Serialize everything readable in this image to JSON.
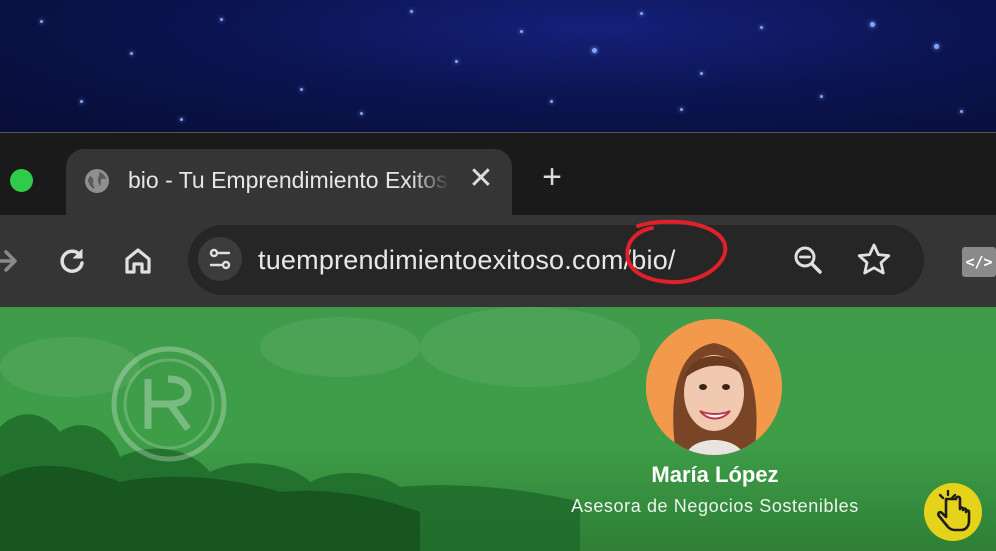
{
  "browser": {
    "tab": {
      "title": "bio - Tu Emprendimiento Exitoso",
      "close_symbol": "✕",
      "favicon": "globe-icon"
    },
    "new_tab_symbol": "+",
    "toolbar": {
      "back_icon": "arrow-right-icon",
      "reload_icon": "reload-icon",
      "home_icon": "home-icon",
      "site_info_icon": "tune-icon",
      "url": "tuemprendimientoexitoso.com/bio/",
      "zoom_icon": "zoom-out-icon",
      "bookmark_icon": "star-icon",
      "extension_label": "</>"
    }
  },
  "page": {
    "profile": {
      "name": "María López",
      "role": "Asesora de Negocios Sostenibles"
    },
    "colors": {
      "background": "#3f9b4a",
      "annotation": "#e0202a",
      "accent_badge": "#e4d31a"
    }
  }
}
